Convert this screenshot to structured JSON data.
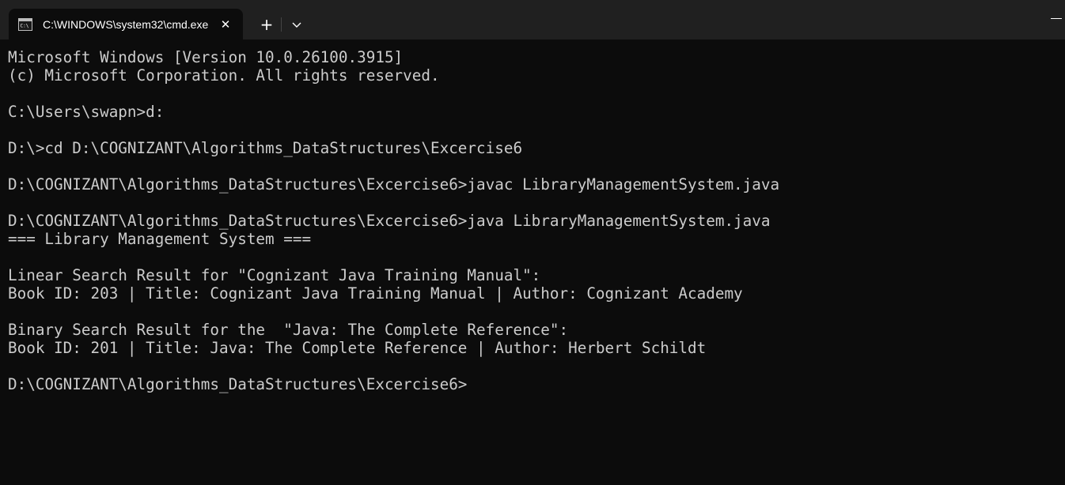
{
  "tab": {
    "title": "C:\\WINDOWS\\system32\\cmd.exe",
    "icon": "cmd-prompt-icon",
    "close_icon": "close-icon"
  },
  "toolbar": {
    "new_tab_label": "+",
    "new_tab_icon": "plus-icon",
    "dropdown_icon": "chevron-down-icon"
  },
  "window_controls": {
    "minimize_icon": "minimize-icon"
  },
  "colors": {
    "terminal_background": "#0c0c0c",
    "terminal_text": "#cccccc",
    "titlebar_background": "#202020",
    "active_tab_background": "#0c0c0c"
  },
  "terminal": {
    "lines": [
      "Microsoft Windows [Version 10.0.26100.3915]",
      "(c) Microsoft Corporation. All rights reserved.",
      "",
      "C:\\Users\\swapn>d:",
      "",
      "D:\\>cd D:\\COGNIZANT\\Algorithms_DataStructures\\Excercise6",
      "",
      "D:\\COGNIZANT\\Algorithms_DataStructures\\Excercise6>javac LibraryManagementSystem.java",
      "",
      "D:\\COGNIZANT\\Algorithms_DataStructures\\Excercise6>java LibraryManagementSystem.java",
      "=== Library Management System ===",
      "",
      "Linear Search Result for \"Cognizant Java Training Manual\":",
      "Book ID: 203 | Title: Cognizant Java Training Manual | Author: Cognizant Academy",
      "",
      "Binary Search Result for the  \"Java: The Complete Reference\":",
      "Book ID: 201 | Title: Java: The Complete Reference | Author: Herbert Schildt",
      "",
      "D:\\COGNIZANT\\Algorithms_DataStructures\\Excercise6>"
    ]
  }
}
